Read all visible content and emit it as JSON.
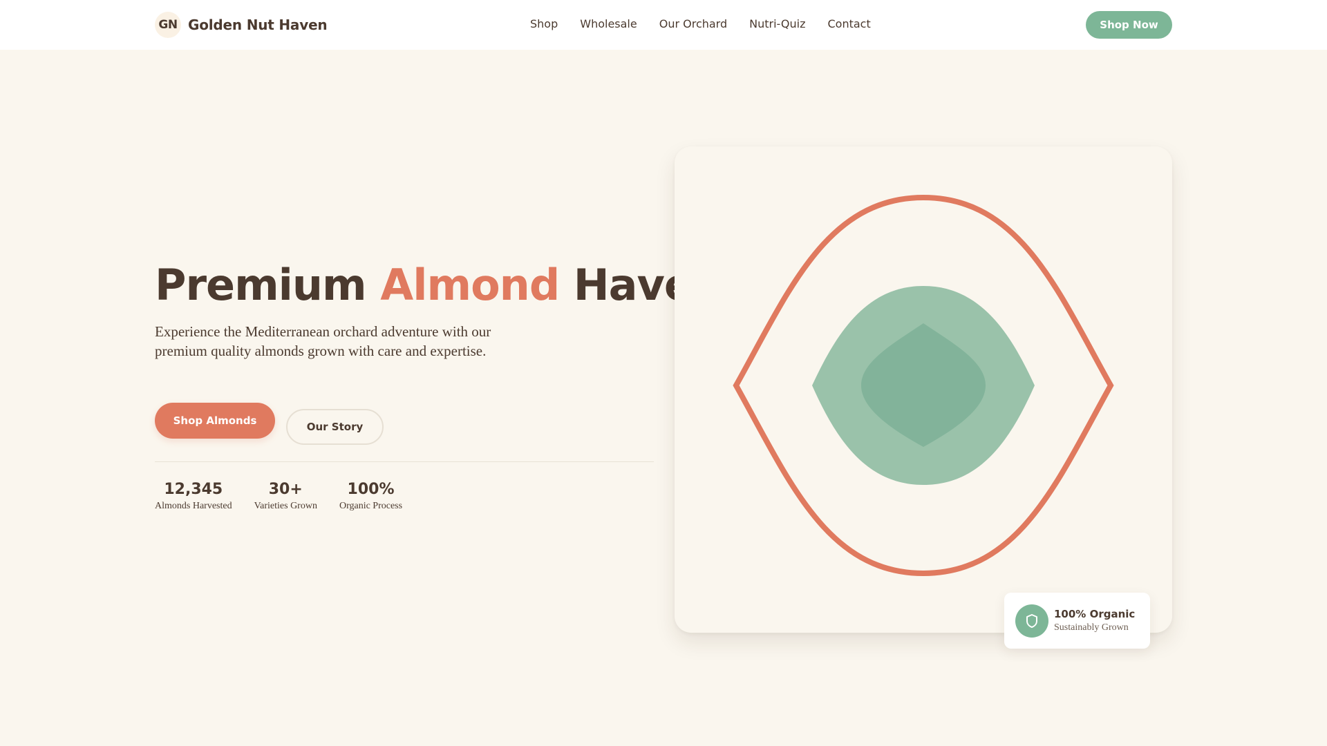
{
  "header": {
    "logo_badge": "GN",
    "brand": "Golden Nut Haven",
    "nav": [
      "Shop",
      "Wholesale",
      "Our Orchard",
      "Nutri-Quiz",
      "Contact"
    ],
    "cta": "Shop Now"
  },
  "hero": {
    "title_part1": "Premium ",
    "title_accent": "Almond",
    "title_part2": " Haven",
    "description": "Experience the Mediterranean orchard adventure with our premium quality almonds grown with care and expertise.",
    "primary_button": "Shop Almonds",
    "secondary_button": "Our Story",
    "stats": [
      {
        "value": "12,345",
        "label": "Almonds Harvested"
      },
      {
        "value": "30+",
        "label": "Varieties Grown"
      },
      {
        "value": "100%",
        "label": "Organic Process"
      }
    ]
  },
  "badge": {
    "title": "100% Organic",
    "subtitle": "Sustainably Grown",
    "icon": "shield-icon"
  },
  "colors": {
    "background": "#faf6ee",
    "text": "#4b3a2f",
    "accent": "#e07a5f",
    "green": "#7db697",
    "green_light": "#9ac2aa",
    "green_dark": "#82b39a"
  }
}
